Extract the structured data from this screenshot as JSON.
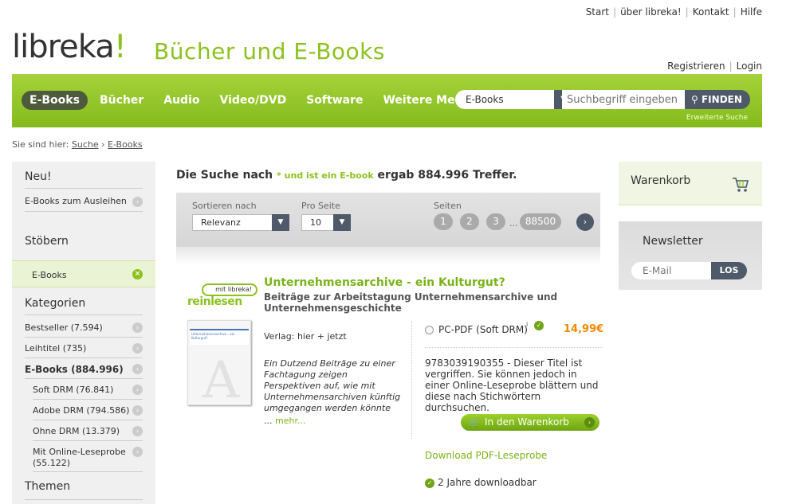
{
  "top_links": [
    "Start",
    "über libreka!",
    "Kontakt",
    "Hilfe"
  ],
  "account_links": [
    "Registrieren",
    "Login"
  ],
  "logo": {
    "text": "libreka",
    "bang": "!"
  },
  "tagline": "Bücher und E-Books",
  "nav": {
    "items": [
      "E-Books",
      "Bücher",
      "Audio",
      "Video/DVD",
      "Software",
      "Weitere Medien"
    ],
    "active": "E-Books"
  },
  "search": {
    "category": "E-Books",
    "placeholder": "Suchbegriff eingeben",
    "button": "FINDEN",
    "advanced": "Erweiterte Suche"
  },
  "breadcrumb": {
    "prefix": "Sie sind hier:",
    "items": [
      "Suche",
      "E-Books"
    ],
    "sep": "›"
  },
  "sidebar": {
    "new_heading": "Neu!",
    "new_link": "E-Books zum Ausleihen",
    "browse_heading": "Stöbern",
    "selected": "E-Books",
    "categories_heading": "Kategorien",
    "categories": [
      {
        "label": "Bestseller (7.594)"
      },
      {
        "label": "Leihtitel (735)"
      },
      {
        "label": "E-Books (884.996)"
      },
      {
        "label": "Soft DRM (76.841)"
      },
      {
        "label": "Adobe DRM (794.586)"
      },
      {
        "label": "Ohne DRM (13.379)"
      },
      {
        "label": "Mit Online-Leseprobe (55.122)"
      }
    ],
    "themes_heading": "Themen"
  },
  "results": {
    "prefix": "Die Suche nach",
    "query": "* und ist ein E-book",
    "suffix": "ergab 884.996 Treffer."
  },
  "sort": {
    "sort_label": "Sortieren nach",
    "sort_value": "Relevanz",
    "per_page_label": "Pro Seite",
    "per_page_value": "10",
    "pages_label": "Seiten",
    "pages": [
      "1",
      "2",
      "3"
    ],
    "ellipsis": "...",
    "last_page": "88500",
    "next": "›"
  },
  "product": {
    "badge_bubble": "mit libreka!",
    "badge_word": "reinlesen",
    "cover_title": "Unternehmensarchive - ein Kulturgut?",
    "title": "Unternehmensarchive - ein Kulturgut?",
    "subtitle": "Beiträge zur Arbeitstagung Unternehmensarchive und Unternehmensgeschichte",
    "publisher": "Verlag: hier + jetzt",
    "description": "Ein Dutzend Beiträge zu einer Fachtagung zeigen Perspektiven auf, wie mit Unternehmensarchiven künftig umgegangen werden könnte",
    "more_prefix": "...",
    "more": "mehr...",
    "format": "PC-PDF (Soft DRM)",
    "format_info": "i",
    "price": "14,99€",
    "note": "9783039190355 - Dieser Titel ist vergriffen. Sie können jedoch in einer Online-Leseprobe blättern und diese nach Stichwörtern durchsuchen.",
    "cart_button": "In den Warenkorb",
    "download_link": "Download PDF-Leseprobe",
    "download_period": "2 Jahre downloadbar"
  },
  "cart": {
    "title": "Warenkorb"
  },
  "newsletter": {
    "title": "Newsletter",
    "placeholder": "E-Mail",
    "button": "LOS"
  },
  "colors": {
    "brand_green": "#8cc21e",
    "dark_slate": "#4e5a6a",
    "price_orange": "#f08a00"
  }
}
